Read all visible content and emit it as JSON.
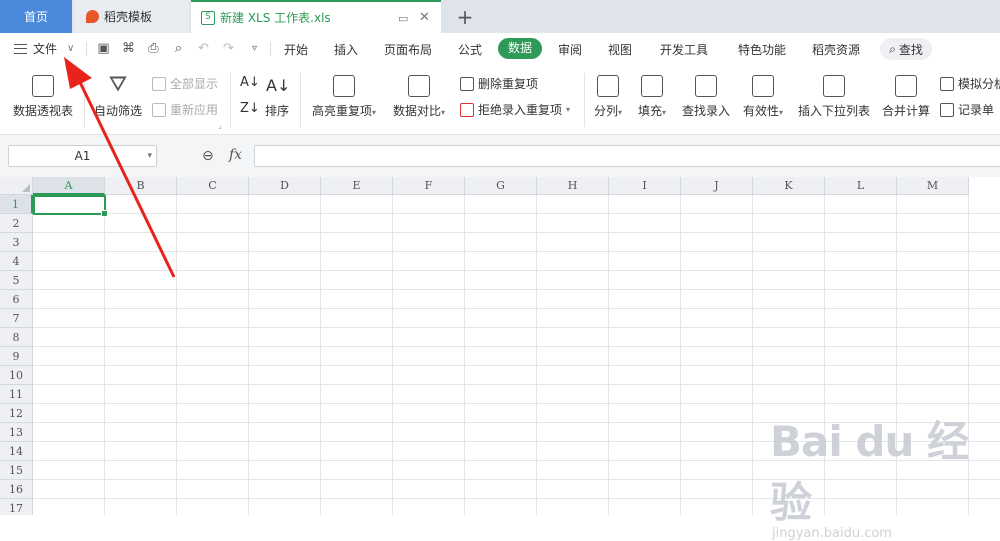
{
  "tabs": {
    "home": "首页",
    "template": "稻壳模板",
    "document": "新建 XLS 工作表.xls",
    "new_tab": "+"
  },
  "menu": {
    "file": "文件",
    "items": [
      "开始",
      "插入",
      "页面布局",
      "公式",
      "数据",
      "审阅",
      "视图",
      "开发工具",
      "特色功能",
      "稻壳资源"
    ],
    "active": "数据",
    "search": "查找"
  },
  "ribbon": {
    "pivot": "数据透视表",
    "autofilter": "自动筛选",
    "show_all": "全部显示",
    "reapply": "重新应用",
    "sort": "排序",
    "highlight_dup": "高亮重复项",
    "compare": "数据对比",
    "delete_dup": "删除重复项",
    "reject_dup": "拒绝录入重复项",
    "split": "分列",
    "fill": "填充",
    "lookup_entry": "查找录入",
    "validity": "有效性",
    "insert_dropdown": "插入下拉列表",
    "consolidate": "合并计算",
    "simulate": "模拟分析",
    "record": "记录单"
  },
  "formula_bar": {
    "name_box": "A1",
    "fx": "fx"
  },
  "grid": {
    "columns": [
      "A",
      "B",
      "C",
      "D",
      "E",
      "F",
      "G",
      "H",
      "I",
      "J",
      "K",
      "L",
      "M"
    ],
    "rows": [
      "1",
      "2",
      "3",
      "4",
      "5",
      "6",
      "7",
      "8",
      "9",
      "10",
      "11",
      "12",
      "13",
      "14",
      "15",
      "16",
      "17"
    ],
    "active_cell": "A1"
  },
  "watermark": {
    "main": "Bai du 经验",
    "sub": "jingyan.baidu.com"
  },
  "colors": {
    "accent": "#2e9a57",
    "home_tab": "#4a89dc",
    "arrow": "#e8231b"
  }
}
